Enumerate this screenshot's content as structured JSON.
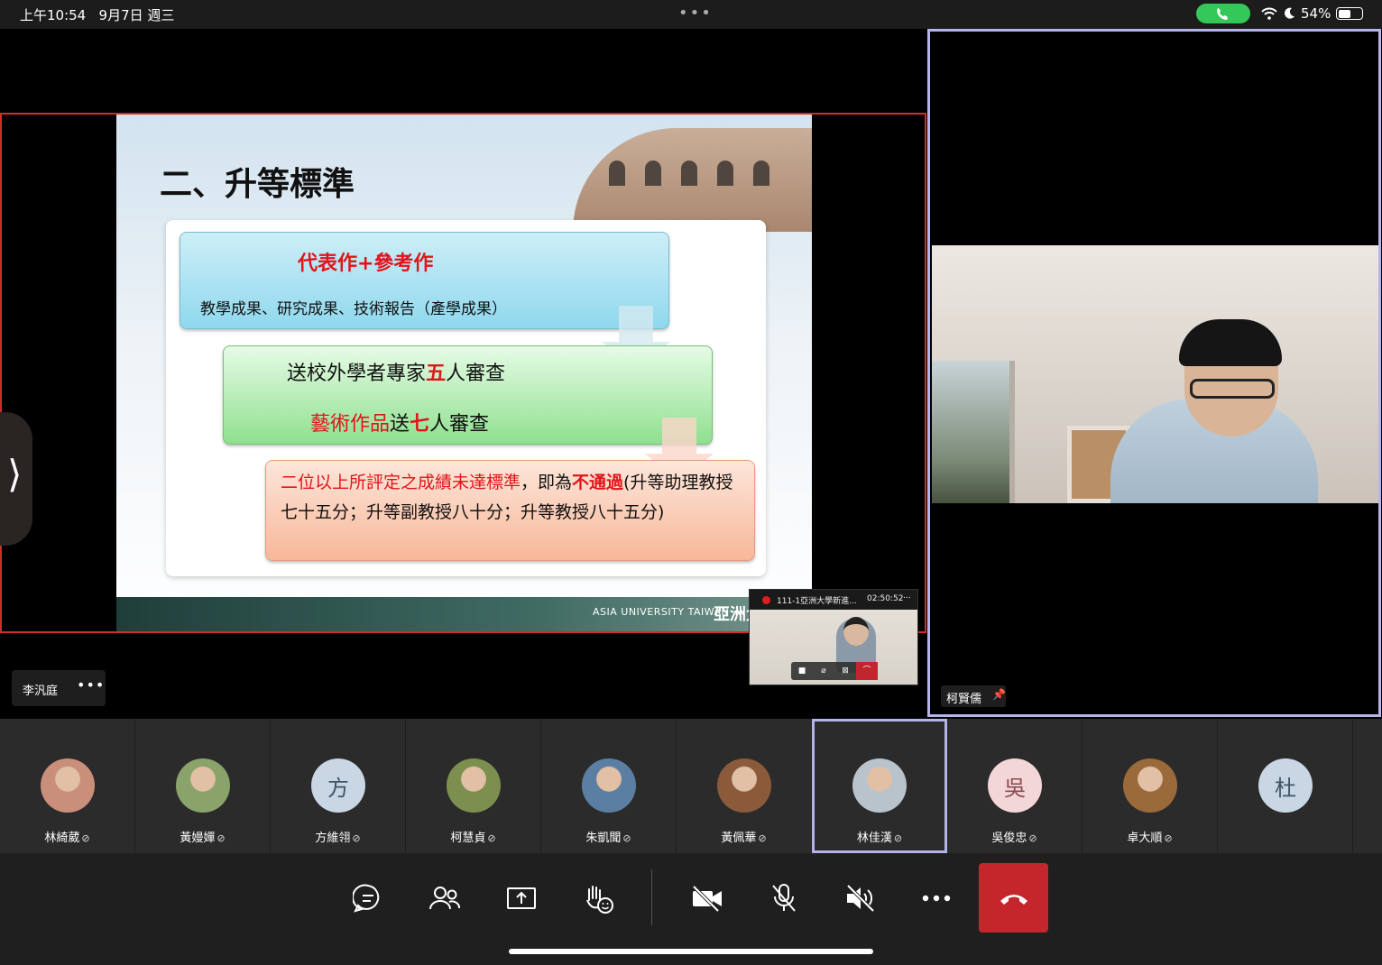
{
  "status_bar": {
    "time": "上午10:54",
    "date": "9月7日 週三",
    "battery": "54%",
    "battery_level": 0.54
  },
  "shared_screen": {
    "presenter_name": "李汎庭",
    "slide": {
      "title": "二、升等標準",
      "box1_title": "代表作+參考作",
      "box1_sub": "教學成果、研究成果、技術報告（產學成果）",
      "box2_line1_a": "送校外學者專家",
      "box2_line1_b": "五",
      "box2_line1_c": "人審查",
      "box2_line2_a": "藝術作品",
      "box2_line2_b": "送",
      "box2_line2_c": "七",
      "box2_line2_d": "人審查",
      "box3_a": "二位以上所評定之成績未達標準",
      "box3_b": "，即為",
      "box3_c": "不通過",
      "box3_d": "(升等助理教授七十五分；升等副教授八十分；升等教授八十五分)",
      "footer_en": "ASIA UNIVERSITY TAIWAN",
      "footer_zh": "亞洲大學"
    },
    "pip": {
      "title": "111-1亞洲大學新進...",
      "timer": "02:50:52",
      "more": "..."
    }
  },
  "pinned_video": {
    "name": "柯賢儒"
  },
  "participants": [
    {
      "name": "林綺葳",
      "avatar": "photo",
      "color": "#c98f7a",
      "active": false
    },
    {
      "name": "黃嫚嬋",
      "avatar": "photo",
      "color": "#8aa36a",
      "active": false
    },
    {
      "name": "方維翎",
      "avatar": "方",
      "color": "#c9d6e3",
      "active": false
    },
    {
      "name": "柯慧貞",
      "avatar": "photo",
      "color": "#7d8f4f",
      "active": false
    },
    {
      "name": "朱凱聞",
      "avatar": "photo",
      "color": "#5b7fa2",
      "active": false
    },
    {
      "name": "黃佩華",
      "avatar": "photo",
      "color": "#8a5a3a",
      "active": false
    },
    {
      "name": "林佳漢",
      "avatar": "photo",
      "color": "#b9c3cb",
      "active": true
    },
    {
      "name": "吳俊忠",
      "avatar": "吳",
      "color": "#f3d6d8",
      "active": false
    },
    {
      "name": "卓大順",
      "avatar": "photo",
      "color": "#9a6a3a",
      "active": false
    },
    {
      "name": "",
      "avatar": "杜",
      "color": "#c9d6e3",
      "active": false
    }
  ],
  "icons": {
    "chat": "chat-icon",
    "people": "people-icon",
    "share": "share-icon",
    "react": "reaction-icon",
    "camera": "camera-off-icon",
    "mic": "mic-off-icon",
    "speaker": "speaker-off-icon",
    "more": "more-icon",
    "hangup": "hangup-icon"
  }
}
